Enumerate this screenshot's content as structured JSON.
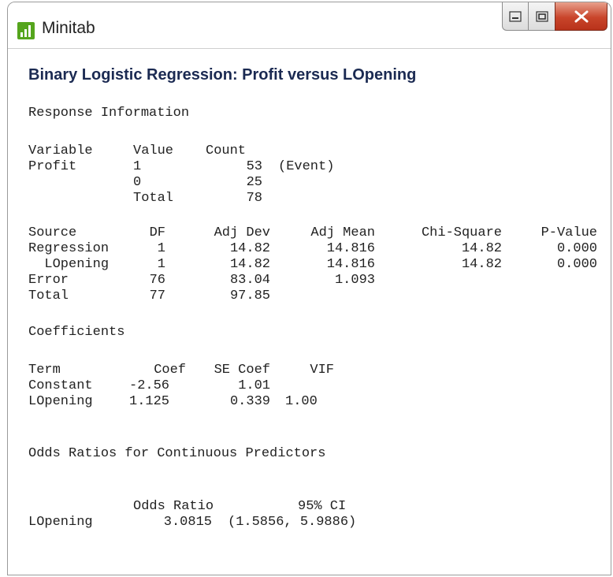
{
  "window": {
    "title": "Minitab",
    "controls": {
      "minimize": "minimize-icon",
      "maximize": "maximize-icon",
      "close": "close-icon"
    },
    "close_color": "#c9452b"
  },
  "heading": "Binary Logistic Regression: Profit versus LOpening",
  "response_info": {
    "title": "Response Information",
    "headers": [
      "Variable",
      "Value",
      "Count",
      ""
    ],
    "rows": [
      [
        "Profit",
        "1",
        "53",
        "(Event)"
      ],
      [
        "",
        "0",
        "25",
        ""
      ],
      [
        "",
        "Total",
        "78",
        ""
      ]
    ]
  },
  "deviance_table": {
    "headers": [
      "Source",
      "DF",
      "Adj Dev",
      "Adj Mean",
      "Chi-Square",
      "P-Value"
    ],
    "rows": [
      [
        "Regression",
        "1",
        "14.82",
        "14.816",
        "14.82",
        "0.000"
      ],
      [
        "  LOpening",
        "1",
        "14.82",
        "14.816",
        "14.82",
        "0.000"
      ],
      [
        "Error",
        "76",
        "83.04",
        "1.093",
        "",
        ""
      ],
      [
        "Total",
        "77",
        "97.85",
        "",
        "",
        ""
      ]
    ]
  },
  "coefficients": {
    "title": "Coefficients",
    "headers": [
      "Term",
      "Coef",
      "SE Coef",
      "VIF"
    ],
    "rows": [
      [
        "Constant",
        "-2.56",
        "1.01",
        ""
      ],
      [
        "LOpening",
        "1.125",
        "0.339",
        "1.00"
      ]
    ]
  },
  "odds_ratios": {
    "title": "Odds Ratios for Continuous Predictors",
    "headers": [
      "Odds Ratio",
      "95% CI"
    ],
    "row": [
      "LOpening",
      "3.0815",
      "(1.5856, 5.9886)"
    ]
  }
}
